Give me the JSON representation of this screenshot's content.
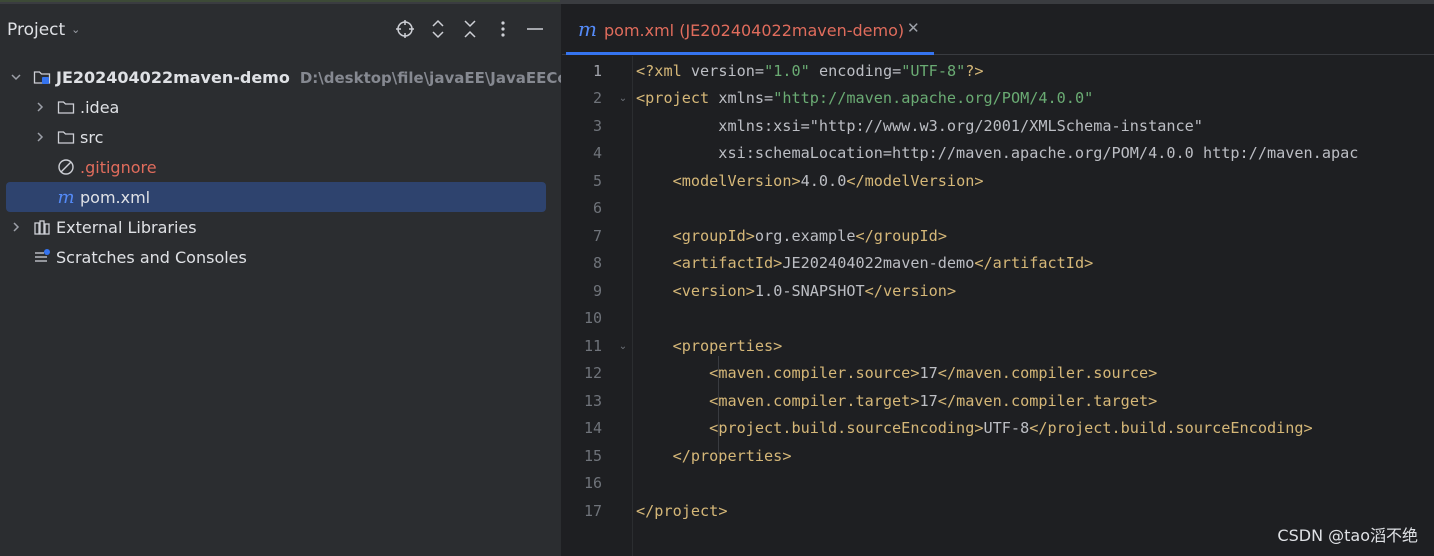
{
  "project_panel": {
    "title": "Project",
    "root": {
      "name": "JE202404022maven-demo",
      "path": "D:\\desktop\\file\\javaEE\\JavaEECod"
    },
    "items": [
      {
        "label": ".idea",
        "icon": "folder-icon",
        "color": "#dfe1e5"
      },
      {
        "label": "src",
        "icon": "folder-icon",
        "color": "#dfe1e5"
      },
      {
        "label": ".gitignore",
        "icon": "ignored-file-icon",
        "color": "#e06c5c"
      },
      {
        "label": "pom.xml",
        "icon": "maven-icon",
        "color": "#dfe1e5",
        "selected": true
      }
    ],
    "external_libraries": "External Libraries",
    "scratches": "Scratches and Consoles"
  },
  "editor": {
    "tab": {
      "label": "pom.xml (JE202404022maven-demo)",
      "icon_glyph": "m"
    },
    "line_numbers": [
      "1",
      "2",
      "3",
      "4",
      "5",
      "6",
      "7",
      "8",
      "9",
      "10",
      "11",
      "12",
      "13",
      "14",
      "15",
      "16",
      "17"
    ],
    "lines": [
      "<?xml version=\"1.0\" encoding=\"UTF-8\"?>",
      "<project xmlns=\"http://maven.apache.org/POM/4.0.0\"",
      "         xmlns:xsi=\"http://www.w3.org/2001/XMLSchema-instance\"",
      "         xsi:schemaLocation=\"http://maven.apache.org/POM/4.0.0 http://maven.apac",
      "    <modelVersion>4.0.0</modelVersion>",
      "",
      "    <groupId>org.example</groupId>",
      "    <artifactId>JE202404022maven-demo</artifactId>",
      "    <version>1.0-SNAPSHOT</version>",
      "",
      "    <properties>",
      "        <maven.compiler.source>17</maven.compiler.source>",
      "        <maven.compiler.target>17</maven.compiler.target>",
      "        <project.build.sourceEncoding>UTF-8</project.build.sourceEncoding>",
      "    </properties>",
      "",
      "</project>"
    ]
  },
  "watermark": "CSDN @tao滔不绝"
}
